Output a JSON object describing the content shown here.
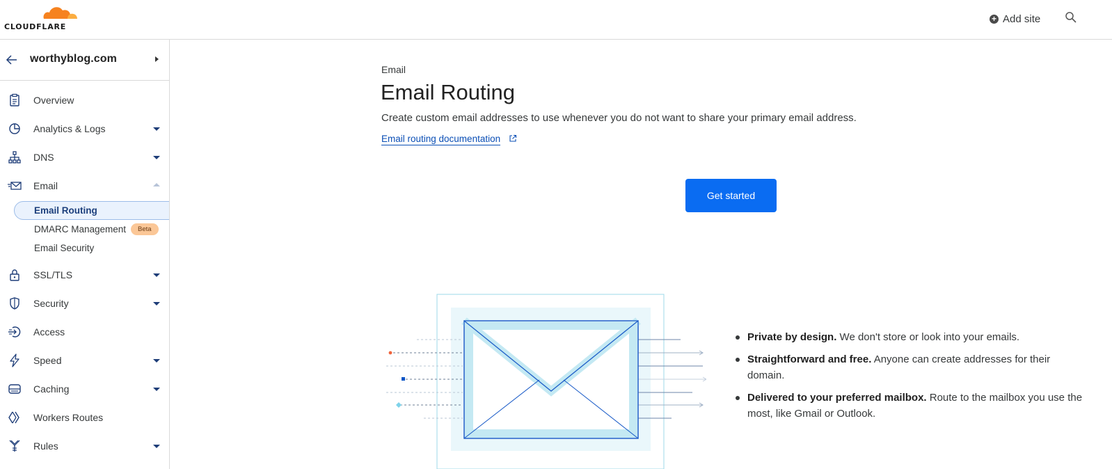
{
  "header": {
    "brand": "CLOUDFLARE",
    "add_site_label": "Add site",
    "colors": {
      "brand_orange": "#f6821f",
      "brand_light_orange": "#fbad41"
    }
  },
  "sidebar": {
    "site_name": "worthyblog.com",
    "items": [
      {
        "label": "Overview",
        "icon": "clipboard-icon"
      },
      {
        "label": "Analytics & Logs",
        "icon": "pie-chart-icon"
      },
      {
        "label": "DNS",
        "icon": "network-icon"
      },
      {
        "label": "Email",
        "icon": "email-icon"
      },
      {
        "label": "SSL/TLS",
        "icon": "lock-icon"
      },
      {
        "label": "Security",
        "icon": "shield-icon"
      },
      {
        "label": "Access",
        "icon": "access-icon"
      },
      {
        "label": "Speed",
        "icon": "lightning-icon"
      },
      {
        "label": "Caching",
        "icon": "server-icon"
      },
      {
        "label": "Workers Routes",
        "icon": "workers-icon"
      },
      {
        "label": "Rules",
        "icon": "rules-icon"
      }
    ],
    "email_sub_items": [
      {
        "label": "Email Routing",
        "active": true
      },
      {
        "label": "DMARC Management",
        "badge": "Beta"
      },
      {
        "label": "Email Security"
      }
    ]
  },
  "main": {
    "breadcrumb": "Email",
    "title": "Email Routing",
    "subtitle": "Create custom email addresses to use whenever you do not want to share your primary email address.",
    "doc_link_label": "Email routing documentation",
    "get_started_label": "Get started",
    "features": [
      {
        "bold": "Private by design.",
        "text": " We don't store or look into your emails."
      },
      {
        "bold": "Straightforward and free.",
        "text": " Anyone can create addresses for their domain."
      },
      {
        "bold": "Delivered to your preferred mailbox.",
        "text": " Route to the mailbox you use the most, like Gmail or Outlook."
      }
    ],
    "colors": {
      "primary_button": "#0a6cf2",
      "link": "#0a4eb5",
      "illustration_light": "#c4e9f3"
    }
  }
}
